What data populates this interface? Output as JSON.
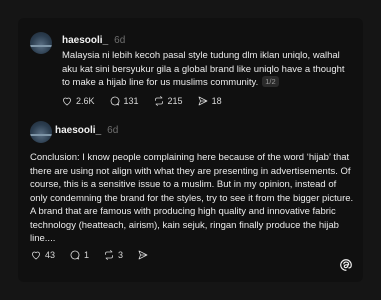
{
  "post1": {
    "username": "haesooli_",
    "time": "6d",
    "text": "Malaysia ni lebih kecoh pasal style tudung dlm iklan uniqlo, walhal aku kat sini bersyukur gila a global brand like uniqlo have a thought to make a hijab line for us muslims community.",
    "counter": "1/2",
    "likes": "2.6K",
    "replies": "131",
    "reposts": "215",
    "shares": "18"
  },
  "post2": {
    "username": "haesooli_",
    "time": "6d",
    "text": "Conclusion: I know people complaining here because of the word ‘hijab’ that there are using not align with what they are presenting in advertisements. Of course, this is a sensitive issue to a muslim. But in my opinion, instead of only condemning the brand for the styles, try to see it from the bigger picture. A brand that are famous with producing high quality and innovative fabric technology (heatteach, airism), kain sejuk, ringan finally produce the hijab line....",
    "likes": "43",
    "replies": "1",
    "reposts": "3"
  },
  "icons": {
    "like": "heart-icon",
    "reply": "comment-icon",
    "repost": "repost-icon",
    "share": "send-icon",
    "logo": "threads-logo-icon"
  }
}
